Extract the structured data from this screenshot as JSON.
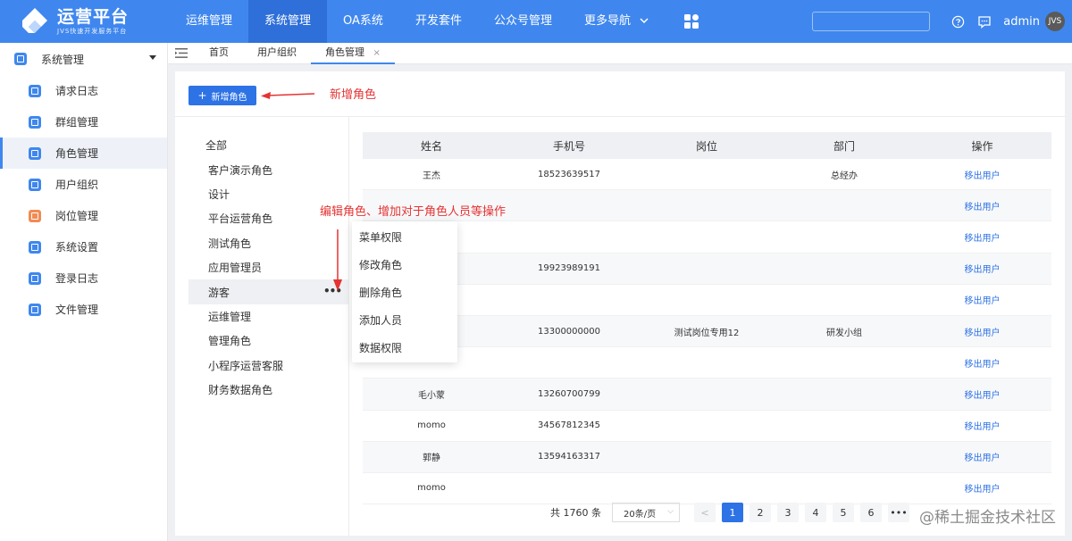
{
  "brand": {
    "title": "运营平台",
    "subtitle": "JVS快速开发服务平台"
  },
  "topnav": {
    "items": [
      {
        "label": "运维管理"
      },
      {
        "label": "系统管理",
        "active": true
      },
      {
        "label": "OA系统"
      },
      {
        "label": "开发套件"
      },
      {
        "label": "公众号管理"
      },
      {
        "label": "更多导航"
      }
    ],
    "search_value": "",
    "username": "admin",
    "avatar_text": "JVS"
  },
  "sidebar": {
    "group_label": "系统管理",
    "items": [
      {
        "label": "请求日志",
        "color": "#3f87ee"
      },
      {
        "label": "群组管理",
        "color": "#3f87ee"
      },
      {
        "label": "角色管理",
        "color": "#3f87ee",
        "active": true
      },
      {
        "label": "用户组织",
        "color": "#3f87ee"
      },
      {
        "label": "岗位管理",
        "color": "#f28b54"
      },
      {
        "label": "系统设置",
        "color": "#3f87ee"
      },
      {
        "label": "登录日志",
        "color": "#3f87ee"
      },
      {
        "label": "文件管理",
        "color": "#3f87ee"
      }
    ]
  },
  "tabs": [
    {
      "label": "首页"
    },
    {
      "label": "用户组织"
    },
    {
      "label": "角色管理",
      "active": true,
      "close": "×"
    }
  ],
  "toolbar": {
    "add_role_label": "新增角色",
    "plus": "+"
  },
  "annotations": {
    "add_role": "新增角色",
    "context_hint": "编辑角色、增加对于角色人员等操作"
  },
  "roles": {
    "items": [
      "全部",
      "客户演示角色",
      "设计",
      "平台运营角色",
      "测试角色",
      "应用管理员",
      "游客",
      "运维管理",
      "管理角色",
      "小程序运营客服",
      "财务数据角色"
    ],
    "selected_index": 6,
    "more": "•••"
  },
  "context_menu": {
    "items": [
      "菜单权限",
      "修改角色",
      "删除角色",
      "添加人员",
      "数据权限"
    ]
  },
  "table": {
    "headers": [
      "姓名",
      "手机号",
      "岗位",
      "部门",
      "操作"
    ],
    "rows": [
      [
        "王杰",
        "18523639517",
        "",
        "总经办",
        "移出用户"
      ],
      [
        "",
        "",
        "",
        "",
        "移出用户"
      ],
      [
        "",
        "",
        "",
        "",
        "移出用户"
      ],
      [
        "",
        "19923989191",
        "",
        "",
        "移出用户"
      ],
      [
        "",
        "",
        "",
        "",
        "移出用户"
      ],
      [
        "",
        "13300000000",
        "测试岗位专用12",
        "研发小组",
        "移出用户"
      ],
      [
        "",
        "",
        "",
        "",
        "移出用户"
      ],
      [
        "毛小蒙",
        "13260700799",
        "",
        "",
        "移出用户"
      ],
      [
        "momo",
        "34567812345",
        "",
        "",
        "移出用户"
      ],
      [
        "郭静",
        "13594163317",
        "",
        "",
        "移出用户"
      ],
      [
        "momo",
        "",
        "",
        "",
        "移出用户"
      ]
    ]
  },
  "pagination": {
    "total": "共 1760 条",
    "page_size": "20条/页",
    "prev": "<",
    "pages": [
      "1",
      "2",
      "3",
      "4",
      "5",
      "6"
    ],
    "ellipsis": "•••",
    "current": "1"
  },
  "watermark": "@稀土掘金技术社区"
}
